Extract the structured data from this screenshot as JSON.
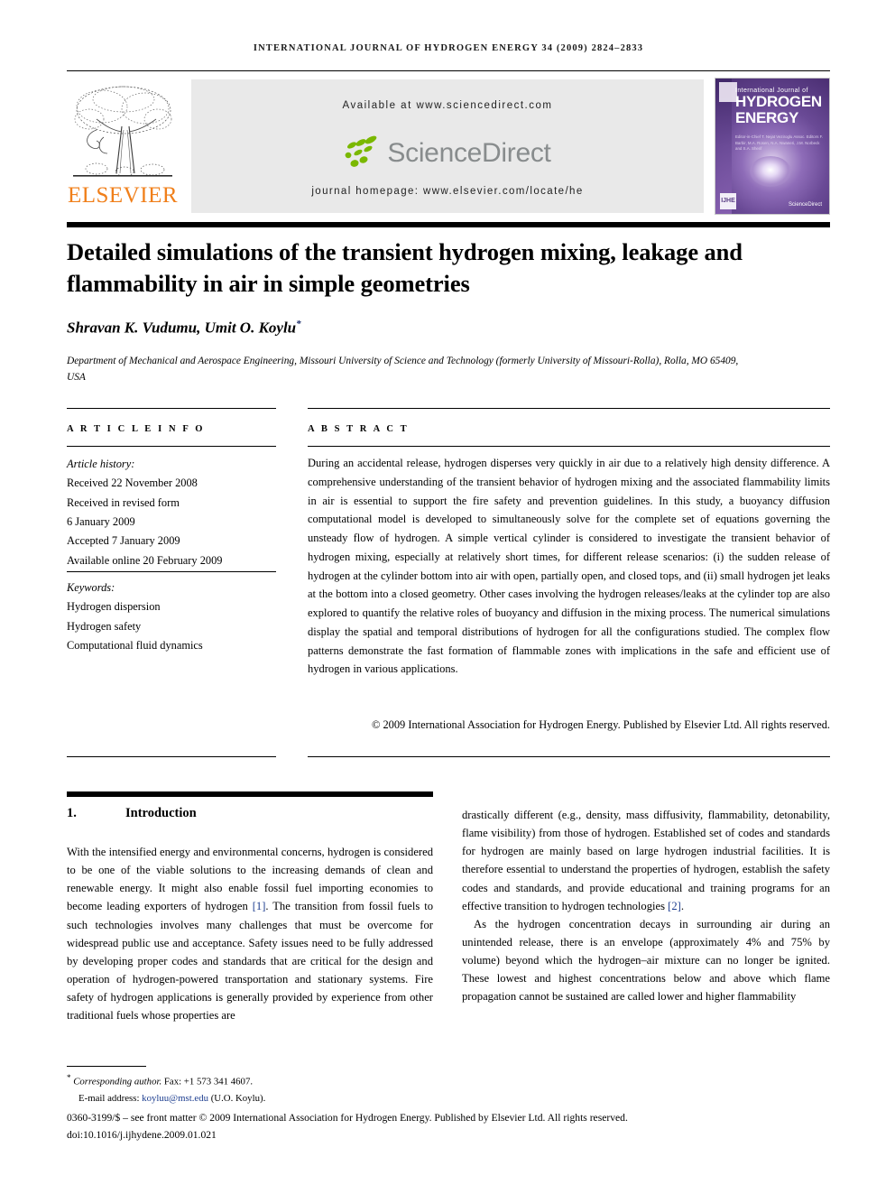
{
  "running_head": "INTERNATIONAL JOURNAL OF HYDROGEN ENERGY 34 (2009) 2824–2833",
  "masthead": {
    "elsevier_wordmark": "ELSEVIER",
    "available_at": "Available at www.sciencedirect.com",
    "sciencedirect_wordmark": "ScienceDirect",
    "journal_homepage": "journal homepage: www.elsevier.com/locate/he",
    "cover": {
      "line1": "International Journal of",
      "line2": "HYDROGEN",
      "line3": "ENERGY",
      "editors": "Editor-in-Chief  T. Nejat Veziroglu\nAssoc. Editors  F. Barbir, M.A. Rosen,\nN.A. Nwaneri, J.M. Norbeck\nand S.A. Sherif",
      "badge": "IJHE",
      "sciencedirect": "ScienceDirect"
    }
  },
  "article": {
    "title": "Detailed simulations of the transient hydrogen mixing, leakage and flammability in air in simple geometries",
    "authors": "Shravan K. Vudumu, Umit O. Koylu",
    "corresponding_marker": "*",
    "affiliation": "Department of Mechanical and Aerospace Engineering, Missouri University of Science and Technology (formerly University of Missouri-Rolla), Rolla, MO 65409, USA"
  },
  "article_info": {
    "heading": "A R T I C L E   I N F O",
    "history_label": "Article history:",
    "history": [
      "Received 22 November 2008",
      "Received in revised form",
      "6 January 2009",
      "Accepted 7 January 2009",
      "Available online 20 February 2009"
    ],
    "keywords_label": "Keywords:",
    "keywords": [
      "Hydrogen dispersion",
      "Hydrogen safety",
      "Computational fluid dynamics"
    ]
  },
  "abstract": {
    "heading": "A B S T R A C T",
    "body": "During an accidental release, hydrogen disperses very quickly in air due to a relatively high density difference. A comprehensive understanding of the transient behavior of hydrogen mixing and the associated flammability limits in air is essential to support the fire safety and prevention guidelines. In this study, a buoyancy diffusion computational model is developed to simultaneously solve for the complete set of equations governing the unsteady flow of hydrogen. A simple vertical cylinder is considered to investigate the transient behavior of hydrogen mixing, especially at relatively short times, for different release scenarios: (i) the sudden release of hydrogen at the cylinder bottom into air with open, partially open, and closed tops, and (ii) small hydrogen jet leaks at the bottom into a closed geometry. Other cases involving the hydrogen releases/leaks at the cylinder top are also explored to quantify the relative roles of buoyancy and diffusion in the mixing process. The numerical simulations display the spatial and temporal distributions of hydrogen for all the configurations studied. The complex flow patterns demonstrate the fast formation of flammable zones with implications in the safe and efficient use of hydrogen in various applications.",
    "copyright": "© 2009 International Association for Hydrogen Energy. Published by Elsevier Ltd. All rights reserved."
  },
  "introduction": {
    "number": "1.",
    "title": "Introduction",
    "left_paragraph": "With the intensified energy and environmental concerns, hydrogen is considered to be one of the viable solutions to the increasing demands of clean and renewable energy. It might also enable fossil fuel importing economies to become leading exporters of hydrogen [1]. The transition from fossil fuels to such technologies involves many challenges that must be overcome for widespread public use and acceptance. Safety issues need to be fully addressed by developing proper codes and standards that are critical for the design and operation of hydrogen-powered transportation and stationary systems. Fire safety of hydrogen applications is generally provided by experience from other traditional fuels whose properties are",
    "right_paragraph_1": "drastically different (e.g., density, mass diffusivity, flammability, detonability, flame visibility) from those of hydrogen. Established set of codes and standards for hydrogen are mainly based on large hydrogen industrial facilities. It is therefore essential to understand the properties of hydrogen, establish the safety codes and standards, and provide educational and training programs for an effective transition to hydrogen technologies [2].",
    "right_paragraph_2": "As the hydrogen concentration decays in surrounding air during an unintended release, there is an envelope (approximately 4% and 75% by volume) beyond which the hydrogen–air mixture can no longer be ignited. These lowest and highest concentrations below and above which flame propagation cannot be sustained are called lower and higher flammability",
    "citation_1": "[1]",
    "citation_2": "[2]"
  },
  "footer": {
    "corresponding_label": "Corresponding author.",
    "fax": "Fax: +1 573 341 4607.",
    "email_label": "E-mail address:",
    "email": "koyluu@mst.edu",
    "email_owner": "(U.O. Koylu).",
    "issn_line": "0360-3199/$ – see front matter © 2009 International Association for Hydrogen Energy. Published by Elsevier Ltd. All rights reserved.",
    "doi": "doi:10.1016/j.ijhydene.2009.01.021"
  },
  "colors": {
    "elsevier_orange": "#F07F1A",
    "sciencedirect_green": "#7AB800",
    "sciencedirect_gray": "#888C8D",
    "link_blue": "#1c3d8f",
    "banner_gray": "#E9E9E9"
  }
}
